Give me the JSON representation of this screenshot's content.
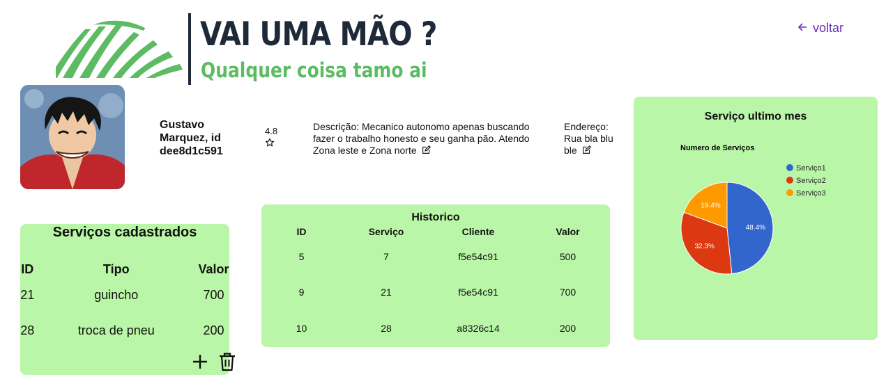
{
  "brand": {
    "title": "VAI UMA MÃO ?",
    "subtitle": "Qualquer coisa tamo ai"
  },
  "nav": {
    "back_label": "voltar",
    "back_icon": "arrow-left-icon"
  },
  "profile": {
    "name": "Gustavo Marquez, id dee8d1c591",
    "rating": "4.8",
    "rating_icon": "star-outline-icon",
    "description": "Descrição: Mecanico autonomo apenas buscando fazer o trabalho honesto e seu ganha pão. Atendo Zona leste e Zona norte",
    "address": "Endereço: Rua bla blu ble",
    "edit_icon": "edit-icon"
  },
  "services": {
    "title": "Serviços cadastrados",
    "columns": [
      "ID",
      "Tipo",
      "Valor"
    ],
    "rows": [
      {
        "id": "21",
        "tipo": "guincho",
        "valor": "700"
      },
      {
        "id": "28",
        "tipo": "troca de pneu",
        "valor": "200"
      }
    ],
    "add_icon": "plus-icon",
    "delete_icon": "trash-icon"
  },
  "history": {
    "title": "Historico",
    "columns": [
      "ID",
      "Serviço",
      "Cliente",
      "Valor"
    ],
    "rows": [
      {
        "id": "5",
        "servico": "7",
        "cliente": "f5e54c91",
        "valor": "500"
      },
      {
        "id": "9",
        "servico": "21",
        "cliente": "f5e54c91",
        "valor": "700"
      },
      {
        "id": "10",
        "servico": "28",
        "cliente": "a8326c14",
        "valor": "200"
      }
    ]
  },
  "chart_panel": {
    "title": "Serviço ultimo mes"
  },
  "chart_data": {
    "type": "pie",
    "title": "Numero de Serviços",
    "legend_position": "right",
    "categories": [
      "Serviço1",
      "Serviço2",
      "Serviço3"
    ],
    "values": [
      48.4,
      32.3,
      19.4
    ],
    "labels": [
      "48.4%",
      "32.3%",
      "19.4%"
    ],
    "colors": [
      "#3366cc",
      "#dc3912",
      "#ff9900"
    ]
  },
  "colors": {
    "card_bg": "#b9f6a7",
    "brand_green": "#5cbb63",
    "brand_dark": "#1e2a38",
    "link_purple": "#6a2fb5"
  }
}
